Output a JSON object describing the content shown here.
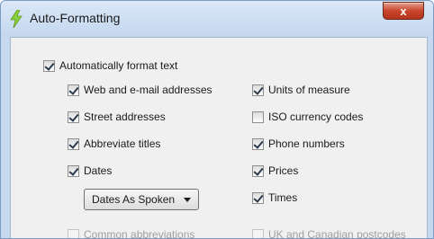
{
  "window": {
    "title": "Auto-Formatting",
    "close_glyph": "x"
  },
  "main": {
    "label": "Automatically format text",
    "checked": true
  },
  "left_options": [
    {
      "label": "Web and e-mail addresses",
      "checked": true
    },
    {
      "label": "Street addresses",
      "checked": true
    },
    {
      "label": "Abbreviate titles",
      "checked": true
    },
    {
      "label": "Dates",
      "checked": true
    },
    {
      "label": "Common abbreviations",
      "checked": false
    }
  ],
  "right_options": [
    {
      "label": "Units of measure",
      "checked": true
    },
    {
      "label": "ISO currency codes",
      "checked": false
    },
    {
      "label": "Phone numbers",
      "checked": true
    },
    {
      "label": "Prices",
      "checked": true
    },
    {
      "label": "Times",
      "checked": true
    },
    {
      "label": "UK and Canadian postcodes",
      "checked": false
    }
  ],
  "dates_format": {
    "selected": "Dates As Spoken"
  },
  "colors": {
    "close_button": "#c8462c",
    "title_bar": "#c3d7ef",
    "app_icon": "#8ccf3c"
  }
}
